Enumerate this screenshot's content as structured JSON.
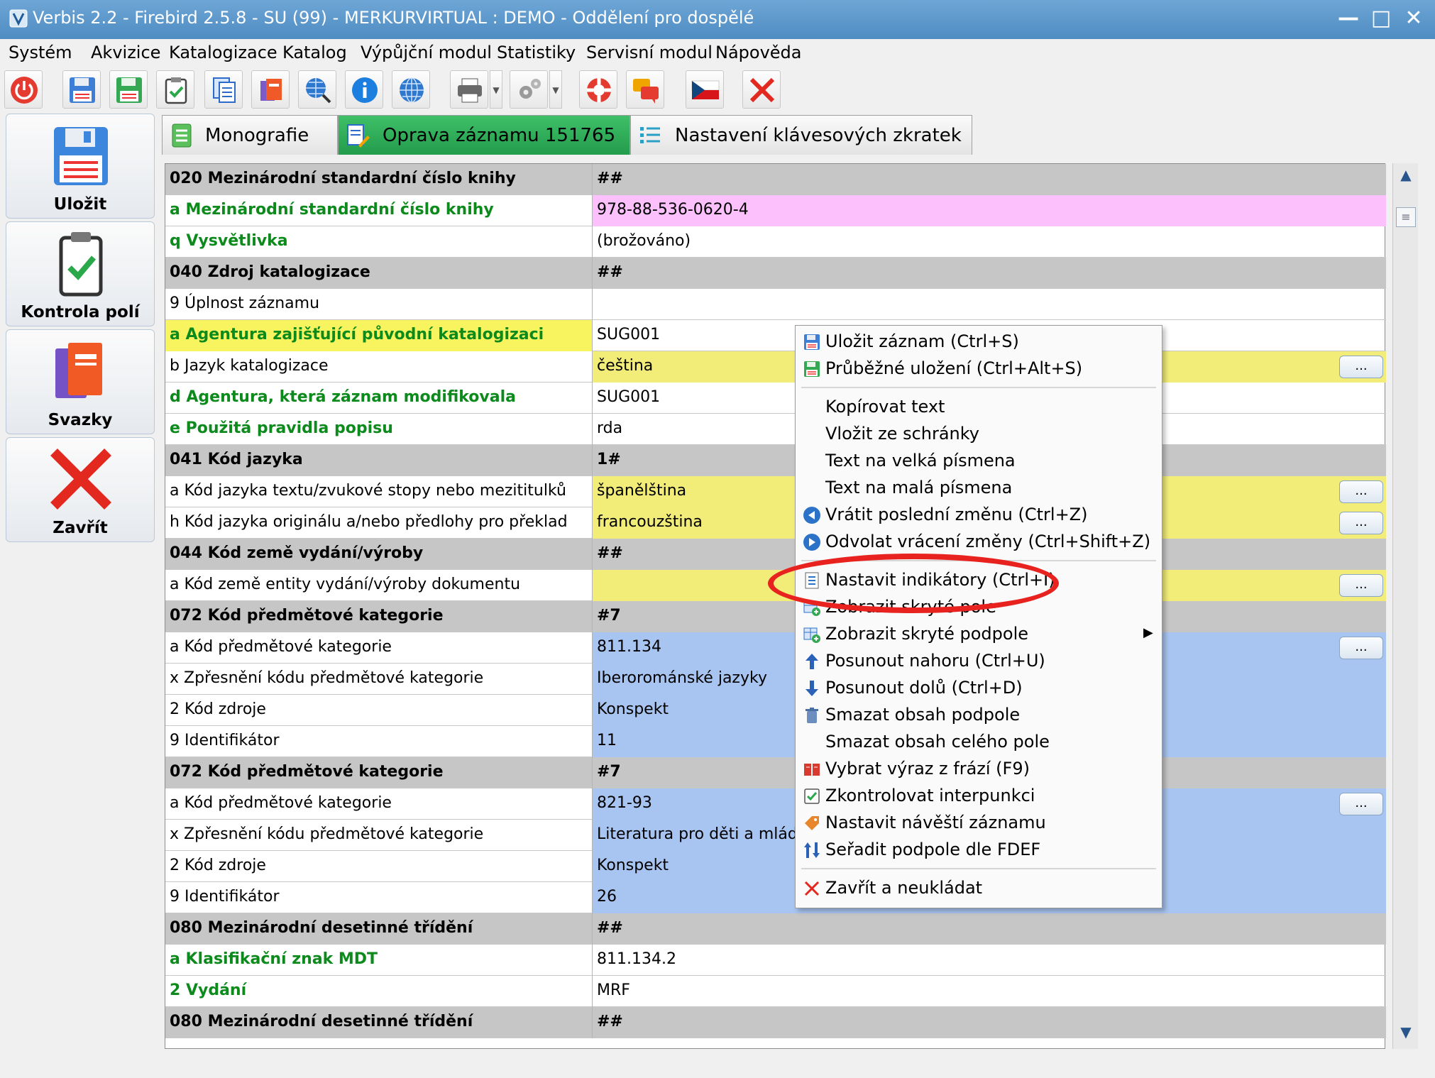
{
  "window": {
    "title": "Verbis 2.2 - Firebird 2.5.8 - SU (99) - MERKURVIRTUAL : DEMO - Oddělení pro dospělé",
    "minimize": "—",
    "maximize": "□",
    "close": "✕"
  },
  "menu": [
    "Systém",
    "Akvizice",
    "Katalogizace",
    "Katalog",
    "Výpůjční modul",
    "Statistiky",
    "Servisní modul",
    "Nápověda"
  ],
  "sidebar": {
    "save": "Uložit",
    "check": "Kontrola polí",
    "volumes": "Svazky",
    "close": "Zavřít"
  },
  "tabs": [
    "Monografie",
    "Oprava záznamu 151765",
    "Nastavení klávesových zkratek"
  ],
  "rows": [
    {
      "label": "020 Mezinárodní standardní číslo knihy",
      "value": "##",
      "type": "header"
    },
    {
      "label": "a Mezinárodní standardní číslo knihy",
      "value": "978-88-536-0620-4",
      "type": "green",
      "bg": "#fcc0fc"
    },
    {
      "label": "q Vysvětlivka",
      "value": "(brožováno)",
      "type": "green",
      "bg": "#ffffff"
    },
    {
      "label": "040 Zdroj katalogizace",
      "value": "##",
      "type": "header"
    },
    {
      "label": "9 Úplnost záznamu",
      "value": "",
      "type": "normal",
      "bg": "#ffffff"
    },
    {
      "label": "a Agentura zajišťující původní katalogizaci",
      "value": "SUG001",
      "type": "green",
      "bg": "#ffffff",
      "labelbg": "#f8f460"
    },
    {
      "label": "b Jazyk katalogizace",
      "value": "čeština",
      "type": "normal",
      "bg": "#f2ec78",
      "btn": "..."
    },
    {
      "label": "d Agentura, která záznam modifikovala",
      "value": "SUG001",
      "type": "green",
      "bg": "#ffffff"
    },
    {
      "label": "e Použitá pravidla popisu",
      "value": "rda",
      "type": "green",
      "bg": "#ffffff"
    },
    {
      "label": "041 Kód jazyka",
      "value": "1#",
      "type": "header"
    },
    {
      "label": "a Kód jazyka textu/zvukové stopy nebo mezititulků",
      "value": "španělština",
      "type": "normal",
      "bg": "#f2ec78",
      "btn": "..."
    },
    {
      "label": "h Kód jazyka originálu a/nebo předlohy pro překlad",
      "value": "francouzština",
      "type": "normal",
      "bg": "#f2ec78",
      "btn": "..."
    },
    {
      "label": "044 Kód země vydání/výroby",
      "value": "##",
      "type": "header"
    },
    {
      "label": "a Kód země entity vydání/výroby dokumentu",
      "value": "",
      "type": "normal",
      "bg": "#f2ec78",
      "btn": "..."
    },
    {
      "label": "072 Kód předmětové kategorie",
      "value": "#7",
      "type": "header"
    },
    {
      "label": "a Kód předmětové kategorie",
      "value": "811.134",
      "type": "normal",
      "bg": "#a8c4f0",
      "btn": "..."
    },
    {
      "label": "x Zpřesnění kódu předmětové kategorie",
      "value": "Iberorománské jazyky",
      "type": "normal",
      "bg": "#a8c4f0"
    },
    {
      "label": "2 Kód zdroje",
      "value": "Konspekt",
      "type": "normal",
      "bg": "#a8c4f0"
    },
    {
      "label": "9 Identifikátor",
      "value": "11",
      "type": "normal",
      "bg": "#a8c4f0"
    },
    {
      "label": "072 Kód předmětové kategorie",
      "value": "#7",
      "type": "header"
    },
    {
      "label": "a Kód předmětové kategorie",
      "value": "821-93",
      "type": "normal",
      "bg": "#a8c4f0",
      "btn": "..."
    },
    {
      "label": "x Zpřesnění kódu předmětové kategorie",
      "value": "Literatura pro děti a mládež (",
      "type": "normal",
      "bg": "#a8c4f0"
    },
    {
      "label": "2 Kód zdroje",
      "value": "Konspekt",
      "type": "normal",
      "bg": "#a8c4f0"
    },
    {
      "label": "9 Identifikátor",
      "value": "26",
      "type": "normal",
      "bg": "#a8c4f0"
    },
    {
      "label": "080 Mezinárodní desetinné třídění",
      "value": "##",
      "type": "header"
    },
    {
      "label": "a Klasifikační znak MDT",
      "value": "811.134.2",
      "type": "green",
      "bg": "#ffffff"
    },
    {
      "label": "2 Vydání",
      "value": "MRF",
      "type": "green",
      "bg": "#ffffff"
    },
    {
      "label": "080 Mezinárodní desetinné třídění",
      "value": "##",
      "type": "header"
    }
  ],
  "context_menu": [
    {
      "label": "Uložit záznam (Ctrl+S)",
      "icon": "save-icon"
    },
    {
      "label": "Průběžné uložení (Ctrl+Alt+S)",
      "icon": "save-green-icon"
    },
    {
      "sep": true
    },
    {
      "label": "Kopírovat text",
      "icon": ""
    },
    {
      "label": "Vložit ze schránky",
      "icon": ""
    },
    {
      "label": "Text na velká písmena",
      "icon": ""
    },
    {
      "label": "Text na malá písmena",
      "icon": ""
    },
    {
      "label": "Vrátit poslední změnu (Ctrl+Z)",
      "icon": "undo-icon"
    },
    {
      "label": "Odvolat vrácení změny (Ctrl+Shift+Z)",
      "icon": "redo-icon"
    },
    {
      "sep": true
    },
    {
      "label": "Nastavit indikátory (Ctrl+I)",
      "icon": "indicators-icon"
    },
    {
      "label": "Zobrazit skryté pole",
      "icon": "show-hidden-field-icon"
    },
    {
      "label": "Zobrazit skryté podpole",
      "icon": "show-hidden-subfield-icon",
      "submenu": true
    },
    {
      "label": "Posunout nahoru (Ctrl+U)",
      "icon": "arrow-up-icon"
    },
    {
      "label": "Posunout dolů (Ctrl+D)",
      "icon": "arrow-down-icon"
    },
    {
      "label": "Smazat obsah podpole",
      "icon": "trash-icon"
    },
    {
      "label": "Smazat obsah celého pole",
      "icon": ""
    },
    {
      "label": "Vybrat výraz z frází (F9)",
      "icon": "phrasebook-icon"
    },
    {
      "label": "Zkontrolovat interpunkci",
      "icon": "checkbox-icon"
    },
    {
      "label": "Nastavit návěští záznamu",
      "icon": "tag-icon"
    },
    {
      "label": "Seřadit podpole dle FDEF",
      "icon": "sort-icon"
    },
    {
      "sep": true
    },
    {
      "label": "Zavřít a neukládat",
      "icon": "close-red-icon"
    }
  ],
  "ellipsis_label": "...",
  "scroll": {
    "up": "▲",
    "down": "▼",
    "thumb": "≡"
  },
  "colors": {
    "header_row": "#c6c6c6",
    "green_text": "#0c8a1c",
    "yellow_value": "#f2ec78",
    "blue_value": "#a8c4f0",
    "pink_value": "#fcc0fc",
    "highlight_oval": "#e8231f"
  }
}
